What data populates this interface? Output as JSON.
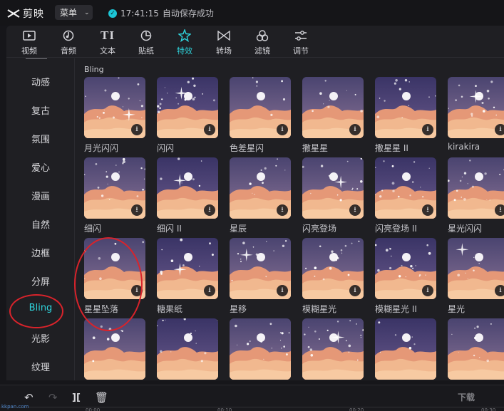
{
  "app": {
    "name": "剪映",
    "menu_label": "菜单",
    "save_time": "17:41:15",
    "save_status": "自动保存成功"
  },
  "toolbar": {
    "active": "特效",
    "items": [
      {
        "label": "视频",
        "icon": "video-icon"
      },
      {
        "label": "音频",
        "icon": "audio-icon"
      },
      {
        "label": "文本",
        "icon": "text-icon"
      },
      {
        "label": "贴纸",
        "icon": "sticker-icon"
      },
      {
        "label": "特效",
        "icon": "effects-icon"
      },
      {
        "label": "转场",
        "icon": "transition-icon"
      },
      {
        "label": "滤镜",
        "icon": "filter-icon"
      },
      {
        "label": "调节",
        "icon": "adjust-icon"
      }
    ]
  },
  "sidebar": {
    "active": "Bling",
    "items": [
      "动感",
      "复古",
      "氛围",
      "爱心",
      "漫画",
      "自然",
      "边框",
      "分屏",
      "Bling",
      "光影",
      "纹理"
    ]
  },
  "content": {
    "section_title": "Bling",
    "effects": [
      "月光闪闪",
      "闪闪",
      "色差星闪",
      "撒星星",
      "撒星星 II",
      "kirakira",
      "细闪",
      "细闪 II",
      "星辰",
      "闪亮登场",
      "闪亮登场 II",
      "星光闪闪",
      "星星坠落",
      "糖果纸",
      "星移",
      "模糊星光",
      "模糊星光 II",
      "星光",
      "",
      "",
      "",
      "",
      "",
      ""
    ]
  },
  "bottom": {
    "icons": [
      "undo-icon",
      "redo-icon",
      "split-icon",
      "delete-icon"
    ],
    "ruler_ticks": [
      "00:00",
      "00:10",
      "00:20",
      "00:30"
    ]
  },
  "watermark": {
    "left": "kkpan.com",
    "right": "下载"
  },
  "colors": {
    "accent": "#2fd5dd",
    "annotation": "#d9232b",
    "panel": "#1f1f23",
    "background": "#16161a"
  }
}
